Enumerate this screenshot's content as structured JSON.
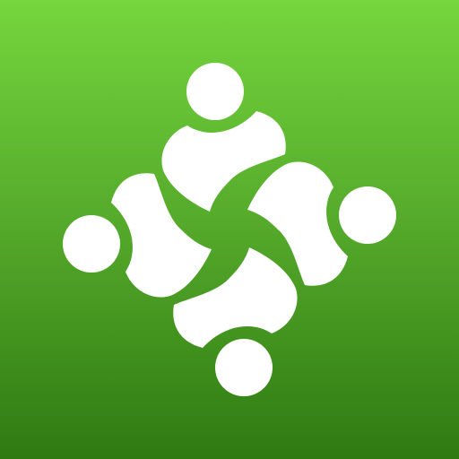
{
  "app_icon": {
    "name": "community-app-icon",
    "logo_icon": "four-people-circle-icon",
    "colors": {
      "background_top": "#75d63d",
      "background_mid": "#57ad2c",
      "background_bottom": "#2f7a12",
      "figure": "#ffffff"
    }
  }
}
